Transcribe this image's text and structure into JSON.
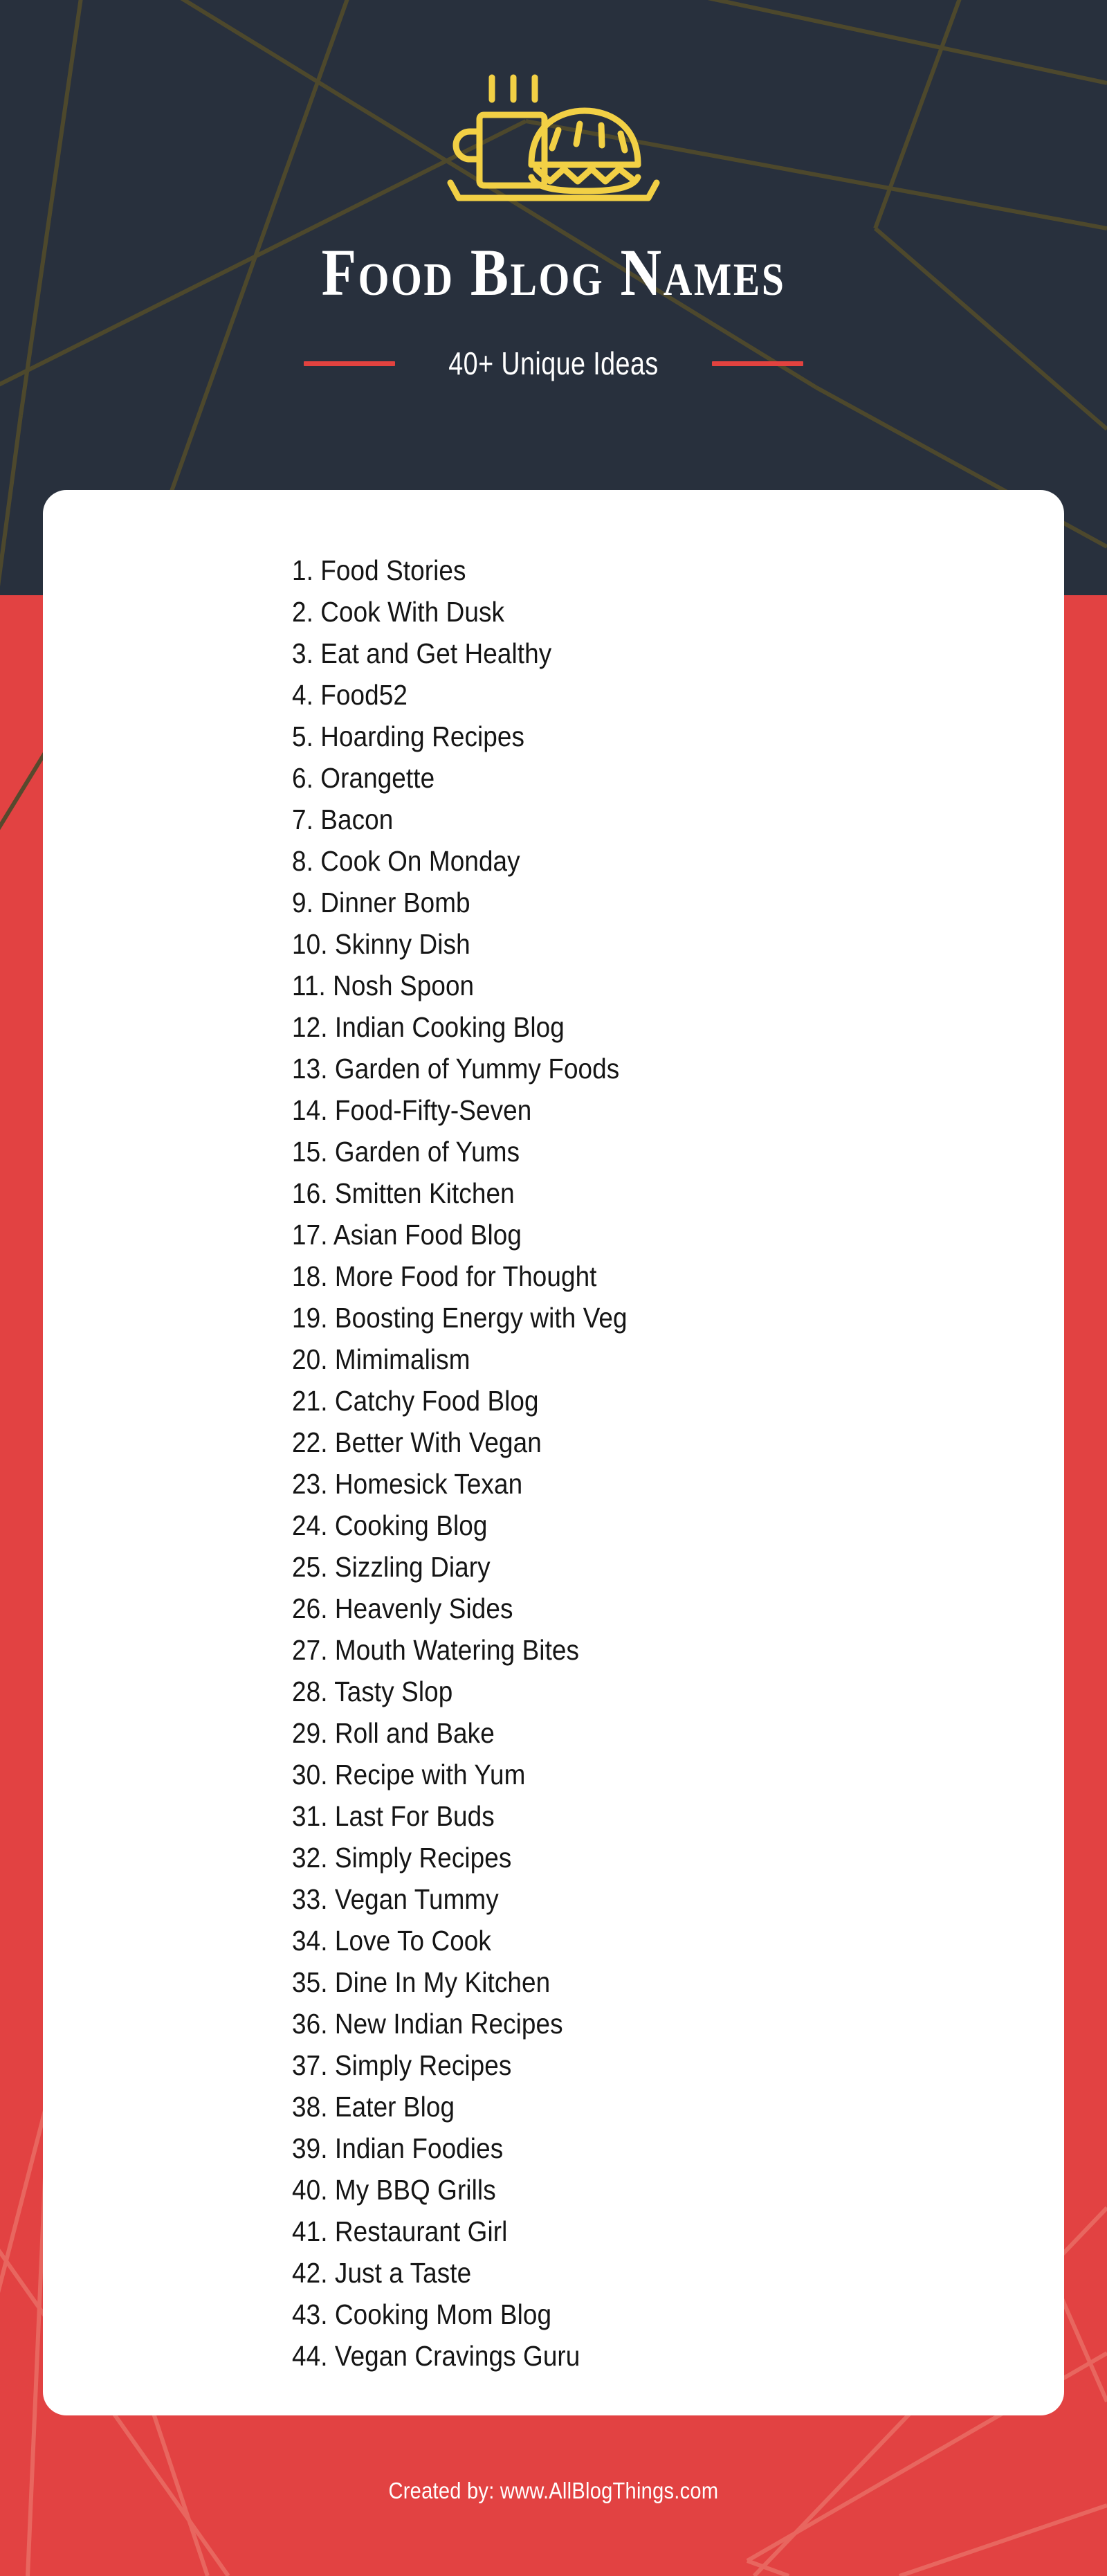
{
  "colors": {
    "header_background": "#28303d",
    "page_background": "#e24242",
    "card_background": "#ffffff",
    "accent_yellow": "#f2d045",
    "accent_red": "#e2423f",
    "title_text": "#ffffff",
    "list_text": "#151515",
    "bg_line_dark": "#4f4a2c",
    "bg_line_red": "#e96a63"
  },
  "header": {
    "logo_icon": "coffee-cup-and-bread-icon",
    "title": "Food Blog Names",
    "subtitle": "40+ Unique Ideas"
  },
  "list": {
    "items": [
      "1. Food Stories",
      "2. Cook With Dusk",
      "3. Eat and Get Healthy",
      "4. Food52",
      "5. Hoarding Recipes",
      "6. Orangette",
      "7. Bacon",
      "8. Cook On Monday",
      "9. Dinner Bomb",
      "10. Skinny Dish",
      "11. Nosh Spoon",
      "12. Indian Cooking Blog",
      "13. Garden of Yummy Foods",
      "14. Food-Fifty-Seven",
      "15. Garden of Yums",
      "16. Smitten Kitchen",
      "17. Asian Food Blog",
      "18. More Food for Thought",
      "19. Boosting Energy with Veg",
      "20. Mimimalism",
      "21. Catchy Food Blog",
      "22. Better With Vegan",
      "23. Homesick Texan",
      "24. Cooking Blog",
      "25. Sizzling Diary",
      "26. Heavenly Sides",
      "27. Mouth Watering Bites",
      "28. Tasty Slop",
      "29. Roll and Bake",
      "30. Recipe with Yum",
      "31. Last For Buds",
      "32. Simply Recipes",
      "33. Vegan Tummy",
      "34. Love To Cook",
      "35. Dine In My Kitchen",
      "36. New Indian Recipes",
      "37. Simply Recipes",
      "38. Eater Blog",
      "39. Indian Foodies",
      "40. My BBQ Grills",
      "41. Restaurant Girl",
      "42. Just a Taste",
      "43. Cooking Mom Blog",
      "44. Vegan Cravings Guru"
    ]
  },
  "footer": {
    "credit": "Created by: www.AllBlogThings.com"
  }
}
